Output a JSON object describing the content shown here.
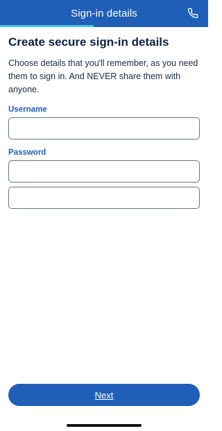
{
  "header": {
    "title": "Sign-in details",
    "phone_icon": "phone-icon",
    "progress_fraction": 0.45
  },
  "main": {
    "heading": "Create secure sign-in details",
    "intro": "Choose details that you'll remember, as you need them to sign in. And NEVER share them with anyone.",
    "username_label": "Username",
    "username_value": "",
    "password_label": "Password",
    "password_value": "",
    "password_confirm_value": ""
  },
  "footer": {
    "next_label": "Next"
  },
  "colors": {
    "brand": "#1f5fb8",
    "accent": "#3ec6e8",
    "heading": "#0d2045"
  }
}
